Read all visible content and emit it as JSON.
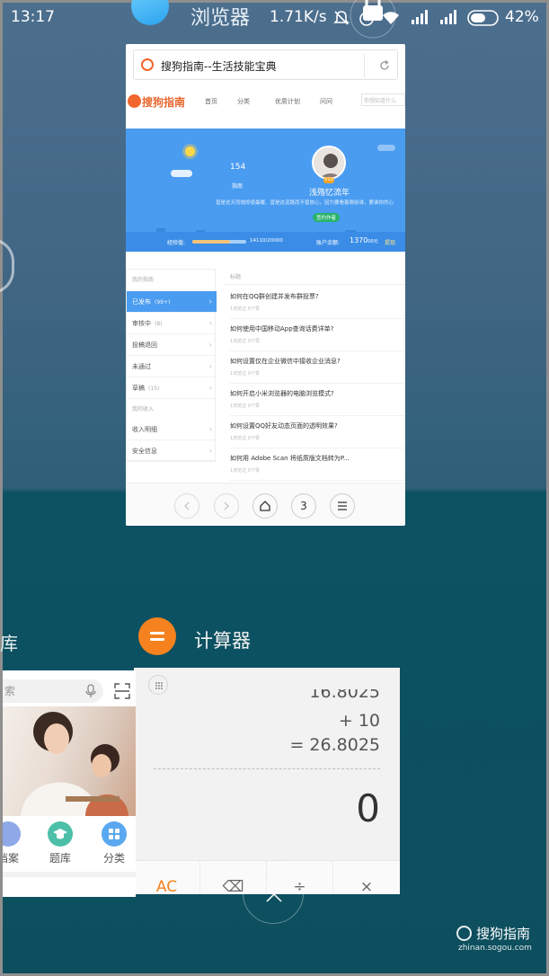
{
  "status_bar": {
    "time": "13:17",
    "speed": "1.71K/s",
    "battery": "42%"
  },
  "browser_app": {
    "label": "浏览器",
    "url_title": "搜狗指南--生活技能宝典",
    "site": {
      "name": "搜狗指南",
      "nav": [
        "首页",
        "分类",
        "优质计划",
        "问问"
      ],
      "search_placeholder": "你想知道什么"
    },
    "profile": {
      "stat_num": "154",
      "stat_label": "指南",
      "username": "浅殇忆流年",
      "badge": "V10",
      "bio": "曾是这天而她即使最暖、曾是这道路而不曾放心，因为要看着眼前谁，要谁你的心",
      "tag": "签约作者",
      "exp_label": "经验值:",
      "exp_value": "14110/20000",
      "exp_progress": 0.7,
      "balance_label": "账户余额:",
      "balance_value": "1370",
      "balance_unit": "00元",
      "balance_link": "提现"
    },
    "menu": {
      "head": "我的指南",
      "items": [
        {
          "label": "已发布",
          "count": "(99+)",
          "active": true
        },
        {
          "label": "审核中",
          "count": "(8)",
          "active": false
        },
        {
          "label": "投稿退回",
          "count": "",
          "active": false
        },
        {
          "label": "未通过",
          "count": "",
          "active": false
        },
        {
          "label": "草稿",
          "count": "(15)",
          "active": false
        }
      ],
      "head2": "我的收入",
      "items2": [
        {
          "label": "收入明细"
        },
        {
          "label": "安全信息"
        }
      ]
    },
    "list": {
      "head": "标题",
      "items": [
        {
          "title": "如何在QQ群创建并发布群投票?",
          "meta": "1浏览过    0个赞"
        },
        {
          "title": "如何使用中国移动App查询话费详单?",
          "meta": "1浏览过    0个赞"
        },
        {
          "title": "如何设置仅在企业微信中接收企业消息?",
          "meta": "1浏览过    0个赞"
        },
        {
          "title": "如何开启小米浏览器的电脑浏览模式?",
          "meta": "1浏览过    0个赞"
        },
        {
          "title": "如何设置QQ好友动态页面的透明效果?",
          "meta": "1浏览过    0个赞"
        },
        {
          "title": "如何用 Adobe Scan 将纸质版文档转为P...",
          "meta": "1浏览过    0个赞"
        }
      ]
    },
    "toolbar": {
      "tab_count": "3"
    }
  },
  "calculator_app": {
    "label": "计算器",
    "line1": "16.8025",
    "line2": "+ 10",
    "line3": "= 26.8025",
    "result": "0",
    "keys": [
      "AC",
      "⌫",
      "÷",
      "×"
    ]
  },
  "library_app": {
    "label": "库",
    "search_placeholder": "索",
    "tabs": [
      {
        "label": "档案",
        "color": "#8ea8e8"
      },
      {
        "label": "题库",
        "color": "#4dbfa8"
      },
      {
        "label": "分类",
        "color": "#5aa8ef"
      }
    ]
  },
  "watermark": {
    "name": "搜狗指南",
    "url": "zhinan.sogou.com"
  },
  "colors": {
    "accent_orange": "#f5821f",
    "profile_blue": "#4a9cf0",
    "sogou_orange": "#f0662c"
  }
}
